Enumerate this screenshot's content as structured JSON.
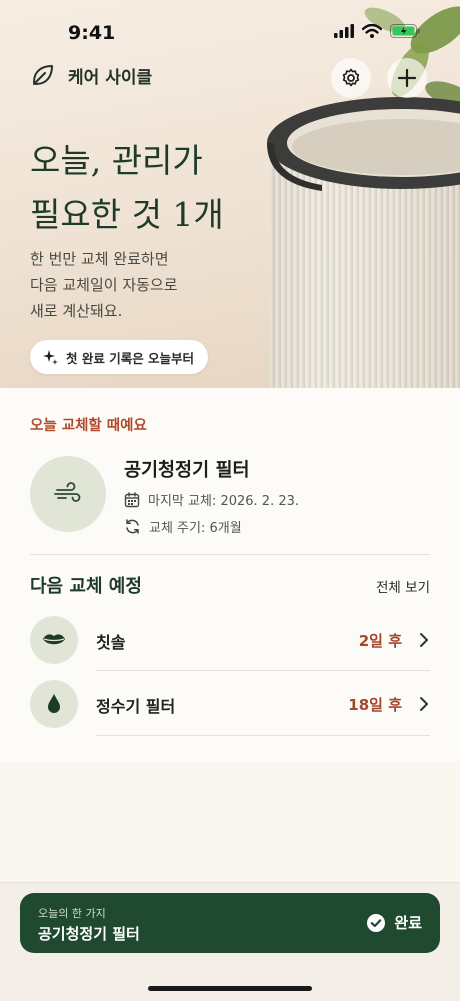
{
  "status": {
    "time": "9:41"
  },
  "header": {
    "brand": "케어 사이클"
  },
  "hero": {
    "title_line1": "오늘, 관리가",
    "title_line2": "필요한 것 1개",
    "sub_line1": "한 번만 교체 완료하면",
    "sub_line2": "다음 교체일이 자동으로",
    "sub_line3": "새로 계산돼요.",
    "pill": "첫 완료 기록은 오늘부터"
  },
  "today": {
    "label": "오늘 교체할 때예요",
    "name": "공기청정기 필터",
    "last": "마지막 교체: 2026. 2. 23.",
    "cycle": "교체 주기: 6개월"
  },
  "next": {
    "title": "다음 교체 예정",
    "see_all": "전체 보기",
    "items": [
      {
        "name": "칫솔",
        "due": "2일 후",
        "icon": "lips-icon"
      },
      {
        "name": "정수기 필터",
        "due": "18일 후",
        "icon": "water-drop-icon"
      }
    ]
  },
  "cta": {
    "small": "오늘의 한 가지",
    "main": "공기청정기 필터",
    "done": "완료"
  },
  "colors": {
    "primary_green": "#1f4a30",
    "accent_orange": "#b04a2a",
    "icon_bg": "#e0e5d6"
  }
}
